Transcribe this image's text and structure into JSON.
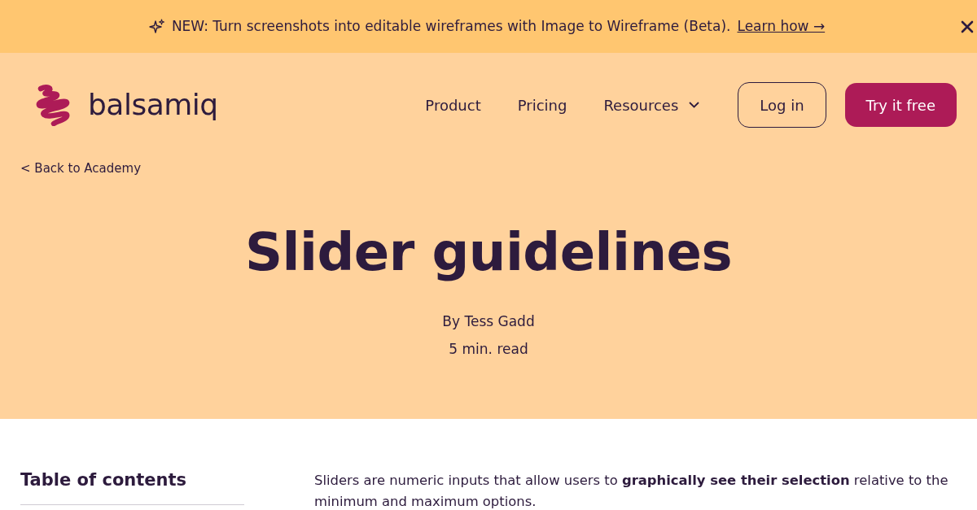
{
  "banner": {
    "message": "NEW: Turn screenshots into editable wireframes with Image to Wireframe (Beta).",
    "link": "Learn how →"
  },
  "header": {
    "logo_text": "balsamiq",
    "nav": [
      {
        "label": "Product",
        "kind": "link"
      },
      {
        "label": "Pricing",
        "kind": "link"
      },
      {
        "label": "Resources",
        "kind": "dropdown"
      }
    ],
    "buttons": [
      {
        "label": "Log in",
        "kind": "outline"
      },
      {
        "label": "Try it free",
        "kind": "primary"
      }
    ]
  },
  "back_link": "< Back to Academy",
  "article": {
    "title": "Slider guidelines",
    "author": "By Tess Gadd",
    "read_time": "5 min. read"
  },
  "toc": {
    "heading": "Table of contents"
  },
  "body": {
    "intro": "Sliders are numeric inputs that allow users to **graphically see their selection** relative to the minimum and maximum options."
  }
}
